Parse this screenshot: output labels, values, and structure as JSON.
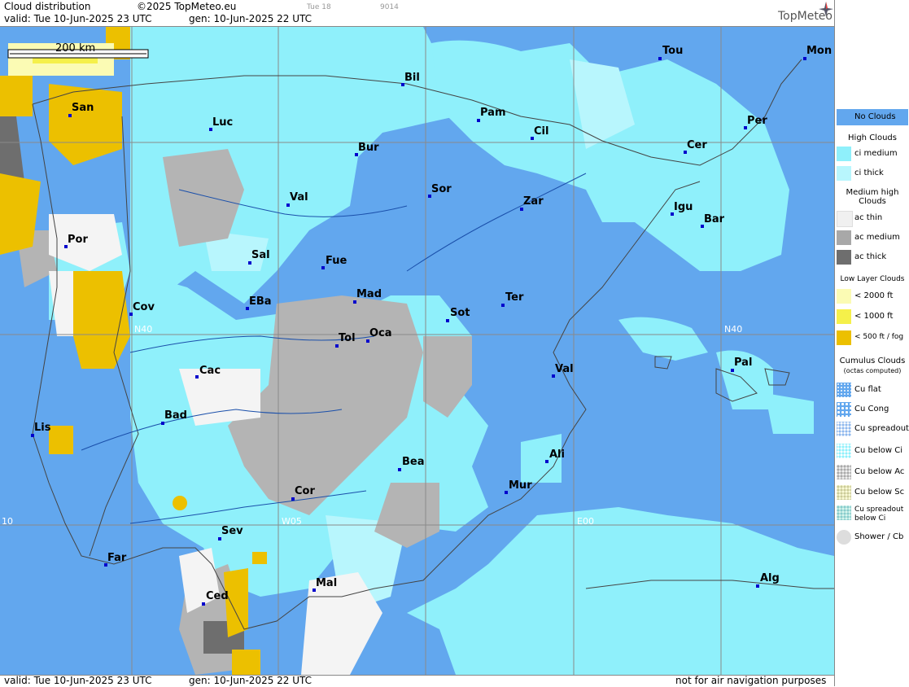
{
  "header": {
    "title": "Cloud distribution",
    "copyright": "©2025 TopMeteo.eu",
    "valid": "valid:  Tue  10-Jun-2025  23 UTC",
    "gen": "gen: 10-Jun-2025 22 UTC",
    "tue": "Tue 18",
    "code": "9014",
    "logo": "TopMeteo"
  },
  "footer": {
    "valid": "valid:  Tue  10-Jun-2025  23 UTC",
    "gen": "gen: 10-Jun-2025 22 UTC",
    "disclaimer": "not for air navigation purposes"
  },
  "scale": "200 km",
  "grid_labels": {
    "n40_left": "N40",
    "n40_right": "N40",
    "w05": "W05",
    "e00": "E00",
    "w10": "10"
  },
  "cities": [
    {
      "name": "San"
    },
    {
      "name": "Bil"
    },
    {
      "name": "Tou"
    },
    {
      "name": "Mon"
    },
    {
      "name": "Luc"
    },
    {
      "name": "Pam"
    },
    {
      "name": "Per"
    },
    {
      "name": "Cil"
    },
    {
      "name": "Bur"
    },
    {
      "name": "Cer"
    },
    {
      "name": "Val"
    },
    {
      "name": "Sor"
    },
    {
      "name": "Zar"
    },
    {
      "name": "Igu"
    },
    {
      "name": "Bar"
    },
    {
      "name": "Por"
    },
    {
      "name": "Sal"
    },
    {
      "name": "Fue"
    },
    {
      "name": "Mad"
    },
    {
      "name": "EBa"
    },
    {
      "name": "Cov"
    },
    {
      "name": "Ter"
    },
    {
      "name": "Sot"
    },
    {
      "name": "Tol"
    },
    {
      "name": "Oca"
    },
    {
      "name": "Pal"
    },
    {
      "name": "Cac"
    },
    {
      "name": "Val"
    },
    {
      "name": "Bad"
    },
    {
      "name": "Lis"
    },
    {
      "name": "Ali"
    },
    {
      "name": "Bea"
    },
    {
      "name": "Mur"
    },
    {
      "name": "Cor"
    },
    {
      "name": "Sev"
    },
    {
      "name": "Far"
    },
    {
      "name": "Alg"
    },
    {
      "name": "Mal"
    },
    {
      "name": "Ced"
    }
  ],
  "legend": {
    "no_clouds": "No Clouds",
    "high_head": "High Clouds",
    "ci_medium": "ci medium",
    "ci_thick": "ci thick",
    "medium_head": "Medium high Clouds",
    "ac_thin": "ac thin",
    "ac_medium": "ac medium",
    "ac_thick": "ac thick",
    "low_head": "Low Layer Clouds",
    "lt2000": "< 2000 ft",
    "lt1000": "< 1000 ft",
    "lt500": "< 500 ft / fog",
    "cu_head": "Cumulus Clouds",
    "cu_sub": "(octas computed)",
    "cu_flat": "Cu flat",
    "cu_cong": "Cu Cong",
    "cu_spread": "Cu spreadout",
    "cu_below_ci": "Cu below Ci",
    "cu_below_ac": "Cu below Ac",
    "cu_below_sc": "Cu below Sc",
    "cu_spread_ci": "Cu spreadout below Ci",
    "shower": "Shower / Cb"
  },
  "colors": {
    "no_clouds": "#62a7ee",
    "ci_medium": "#8ff0fb",
    "ci_thick": "#b8f6fd",
    "ac_thin": "#f0f0f0",
    "ac_medium": "#a8a8a8",
    "ac_thick": "#6e6e6e",
    "low2000": "#fbfbb4",
    "low1000": "#f5f04a",
    "low500": "#ecc000"
  }
}
